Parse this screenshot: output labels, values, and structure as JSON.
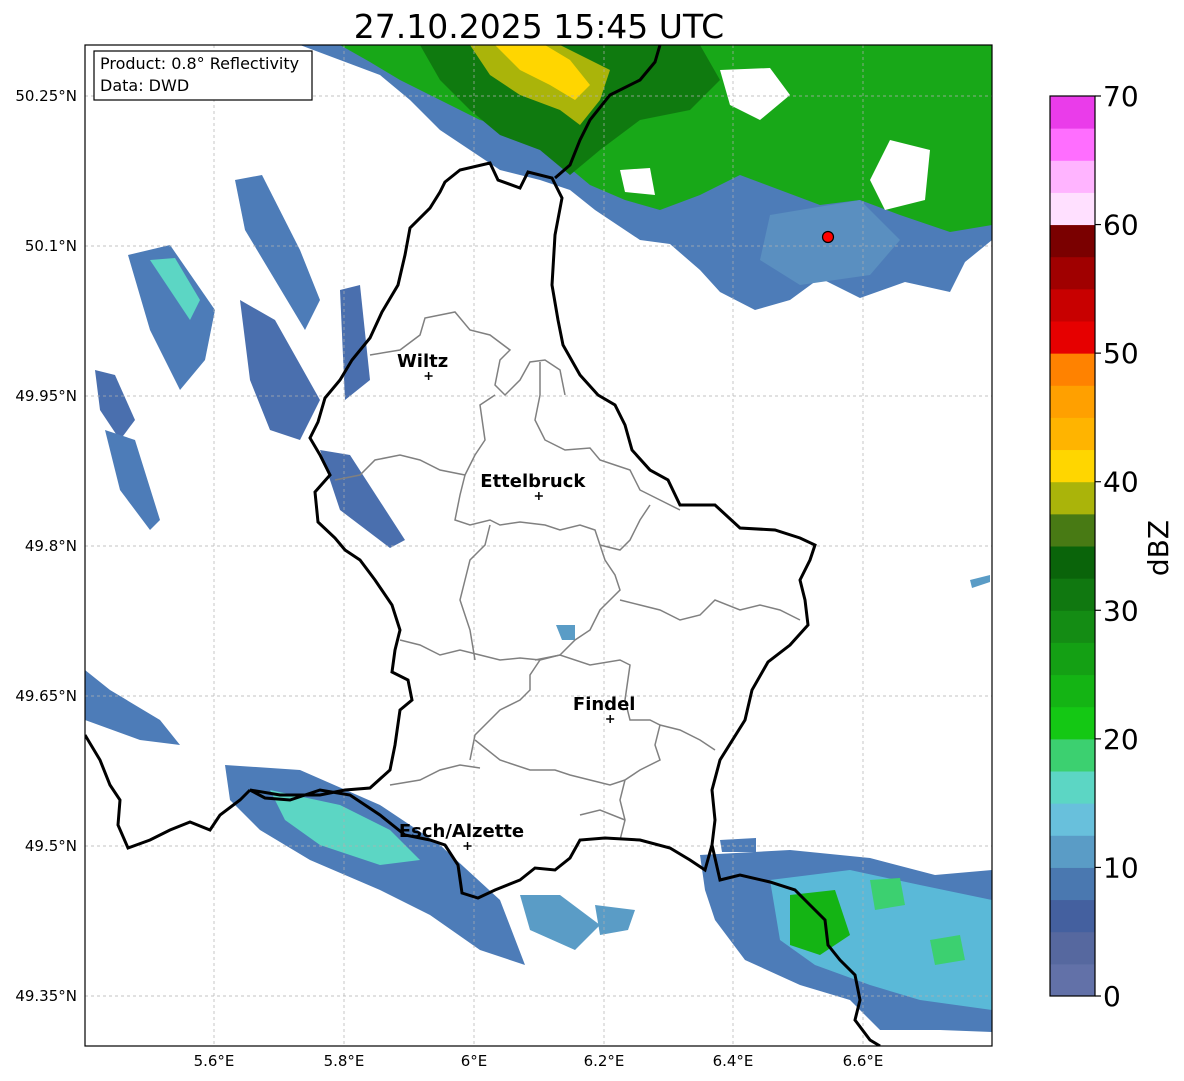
{
  "title": "27.10.2025 15:45 UTC",
  "info_box": {
    "product_line": "Product: 0.8° Reflectivity",
    "data_line": "Data: DWD"
  },
  "map": {
    "lon_range": [
      5.4,
      6.8
    ],
    "lat_range": [
      49.3,
      50.3
    ],
    "lon_ticks": [
      "5.6°E",
      "5.8°E",
      "6°E",
      "6.2°E",
      "6.4°E",
      "6.6°E"
    ],
    "lat_ticks": [
      "50.25°N",
      "50.1°N",
      "49.95°N",
      "49.8°N",
      "49.65°N",
      "49.5°N",
      "49.35°N"
    ],
    "grid": true,
    "radar_site_color": "#ff0000"
  },
  "cities": [
    {
      "name": "Wiltz",
      "lon": 5.93,
      "lat": 49.97
    },
    {
      "name": "Ettelbruck",
      "lon": 6.1,
      "lat": 49.85
    },
    {
      "name": "Findel",
      "lon": 6.21,
      "lat": 49.627
    },
    {
      "name": "Esch/Alzette",
      "lon": 5.99,
      "lat": 49.5
    }
  ],
  "colorbar": {
    "label": "dBZ",
    "ticks": [
      "0",
      "10",
      "20",
      "30",
      "40",
      "50",
      "60",
      "70"
    ],
    "colors": [
      "#6271a8",
      "#56689f",
      "#44609f",
      "#4a78b0",
      "#5a9cc6",
      "#68c0dc",
      "#5cd6c4",
      "#3cd070",
      "#14c814",
      "#14b414",
      "#14a014",
      "#148c14",
      "#107810",
      "#0a640a",
      "#487a14",
      "#aab40a",
      "#ffd600",
      "#ffb400",
      "#ffa000",
      "#ff8200",
      "#e60000",
      "#c80000",
      "#a00000",
      "#7a0000",
      "#ffe0ff",
      "#ffb4ff",
      "#ff6eff",
      "#ea3cea"
    ]
  }
}
